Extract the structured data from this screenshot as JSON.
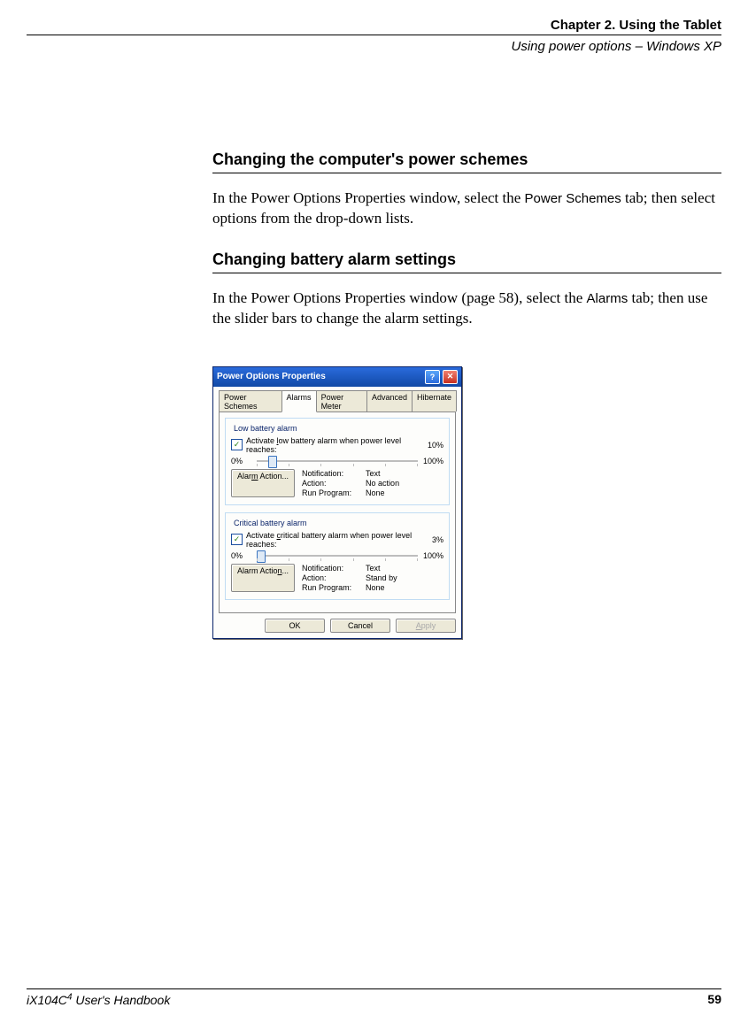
{
  "header": {
    "chapter": "Chapter 2. Using the Tablet",
    "section": "Using power options – Windows XP"
  },
  "s1": {
    "heading": "Changing the computer's power schemes",
    "p_a": "In the Power Options Properties window, select the ",
    "p_b": "Power Schemes",
    "p_c": " tab; then select options from the drop-down lists."
  },
  "s2": {
    "heading": "Changing battery alarm settings",
    "p_a": "In the Power Options Properties window (page 58), select the ",
    "p_b": "Alarms",
    "p_c": " tab; then use the slider bars to change the alarm settings."
  },
  "dialog": {
    "title": "Power Options Properties",
    "tabs": [
      "Power Schemes",
      "Alarms",
      "Power Meter",
      "Advanced",
      "Hibernate"
    ],
    "low": {
      "legend": "Low battery alarm",
      "chk_pre": "Activate ",
      "chk_u": "l",
      "chk_post": "ow battery alarm when power level reaches:",
      "value": "10%",
      "left": "0%",
      "right": "100%",
      "slider_pct": 10,
      "btn_pre": "Alar",
      "btn_u": "m",
      "btn_post": " Action...",
      "info": {
        "k1": "Notification:",
        "v1": "Text",
        "k2": "Action:",
        "v2": "No action",
        "k3": "Run Program:",
        "v3": "None"
      }
    },
    "crit": {
      "legend": "Critical battery alarm",
      "chk_pre": "Activate ",
      "chk_u": "c",
      "chk_post": "ritical battery alarm when power level reaches:",
      "value": "3%",
      "left": "0%",
      "right": "100%",
      "slider_pct": 3,
      "btn_pre": "Alarm Actio",
      "btn_u": "n",
      "btn_post": "...",
      "info": {
        "k1": "Notification:",
        "v1": "Text",
        "k2": "Action:",
        "v2": "Stand by",
        "k3": "Run Program:",
        "v3": "None"
      }
    },
    "buttons": {
      "ok": "OK",
      "cancel": "Cancel",
      "apply_u": "A",
      "apply_post": "pply"
    }
  },
  "footer": {
    "book_a": "iX104C",
    "book_sup": "4",
    "book_b": " User's Handbook",
    "page": "59"
  }
}
